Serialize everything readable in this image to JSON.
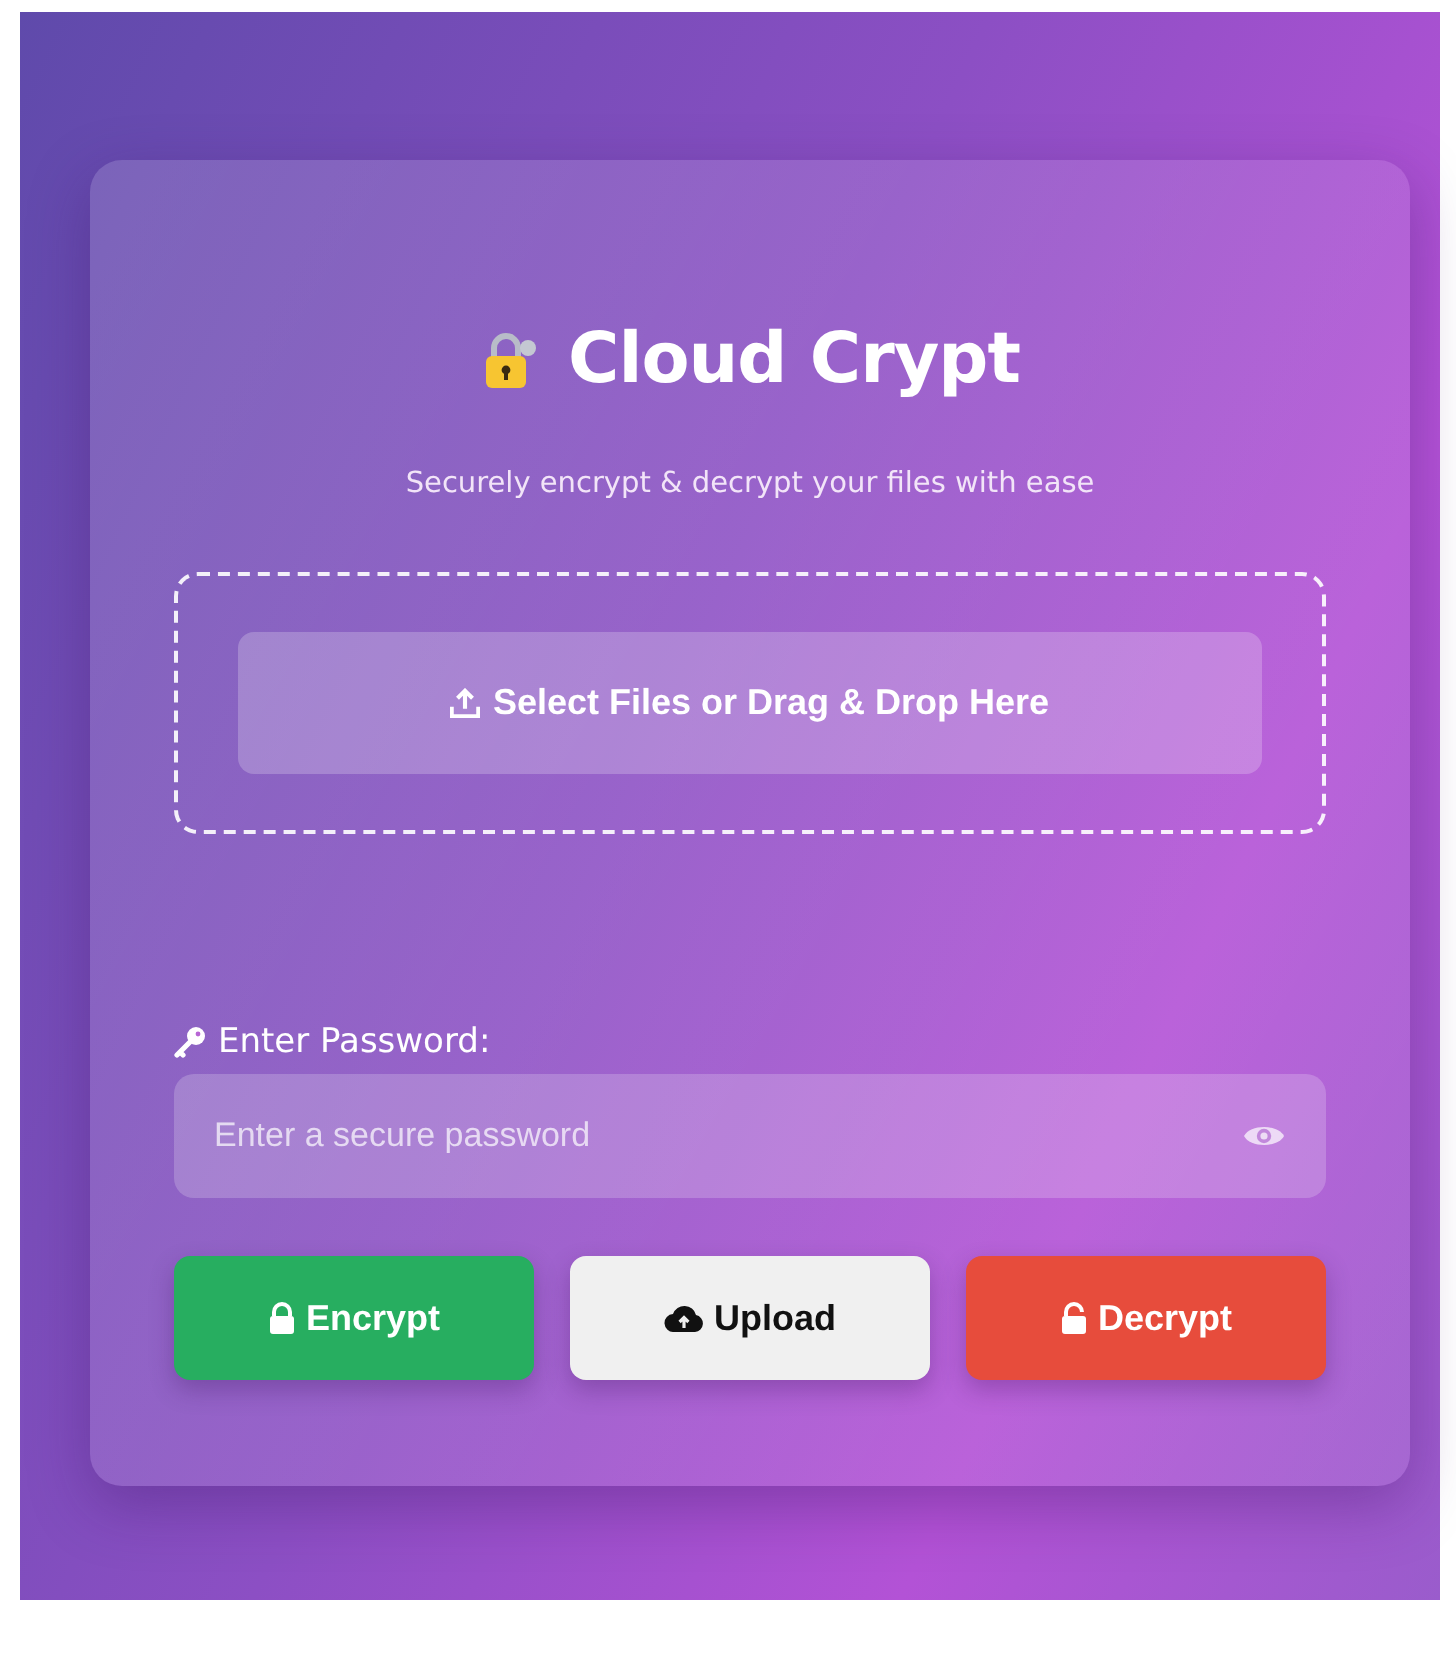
{
  "app": {
    "title": "Cloud Crypt",
    "subtitle": "Securely encrypt & decrypt your files with ease"
  },
  "dropzone": {
    "label": "Select Files or Drag & Drop Here"
  },
  "password": {
    "label": "Enter Password:",
    "placeholder": "Enter a secure password"
  },
  "buttons": [
    {
      "label": "Encrypt",
      "kind": "encrypt"
    },
    {
      "label": "Upload",
      "kind": "upload"
    },
    {
      "label": "Decrypt",
      "kind": "decrypt"
    }
  ]
}
